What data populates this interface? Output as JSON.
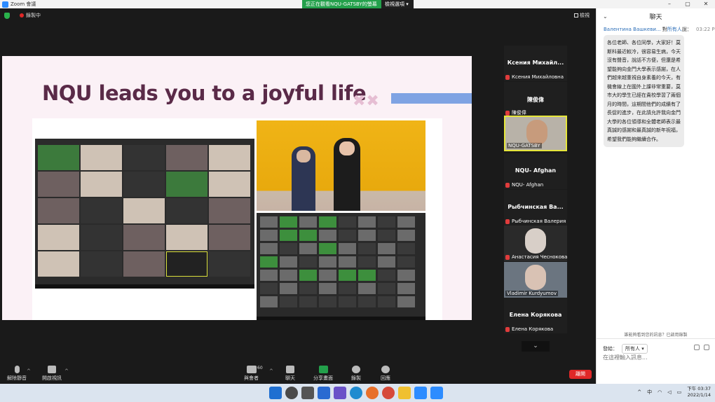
{
  "window": {
    "app_title": "Zoom 會議",
    "share_banner": "您正在觀看NQU-GATSBY的螢幕",
    "view_options": "檢視選項",
    "controls": [
      "–",
      "▢",
      "✕"
    ]
  },
  "meeting": {
    "recording_label": "錄製中",
    "view_label": "檢視",
    "colors": {
      "recording": "#e02828",
      "share_banner": "#23a04b",
      "leave": "#e02828",
      "active_speaker": "#e6e63a"
    }
  },
  "slide": {
    "title": "NQU leads you to a joyful life",
    "decor": "✖✖"
  },
  "participants": [
    {
      "display": "Ксения Михайл...",
      "subtitle": "Ксения Михайловна",
      "type": "name"
    },
    {
      "display": "陳俊偉",
      "subtitle": "陳俊偉",
      "type": "name"
    },
    {
      "display": "",
      "subtitle": "NQU-GATSBY",
      "type": "video-active"
    },
    {
      "display": "NQU- Afghan",
      "subtitle": "NQU- Afghan",
      "type": "name"
    },
    {
      "display": "Рыбчинская Ва...",
      "subtitle": "Рыбчинская Валерия",
      "type": "name"
    },
    {
      "display": "",
      "subtitle": "Анастасия Чеснокова",
      "type": "video"
    },
    {
      "display": "",
      "subtitle": "Vladimir Kurdyumov",
      "type": "video-vk"
    },
    {
      "display": "Елена Корякова",
      "subtitle": "Елена Корякова",
      "type": "name"
    }
  ],
  "toolbar": {
    "unmute": "解除靜音",
    "stop_video": "開啟視訊",
    "participants": "與會者",
    "participants_count": "60",
    "chat": "聊天",
    "share": "分享畫面",
    "record": "錄製",
    "reactions": "回應",
    "leave": "離開"
  },
  "chat": {
    "title": "聊天",
    "sender": "Валентина Вашкеви...",
    "to_prefix": "對",
    "to_target": "所有人",
    "to_suffix": "說：",
    "time": "03:22 PM",
    "message": "各位老師、各位同學，大家好！莫斯科最近較冷，很容易生病，今天沒有聲音，說話不方便，但還是希望能夠向金門大學表示感謝，在人們越來越重視自身素養的今天，有機會線上在國外上課非常重要，莫市大的學生已經在貴校學習了兩個月的時間，這期間他們的成績有了長促的進步，在此請允許我向金門大學的各位領導和全體老師表示最真誠的感謝和最真誠的新年祝福，希望我們能夠繼續合作。",
    "note": "誰能夠看到您的訊息？已啟用錄製",
    "send_to_label": "發給：",
    "send_to_value": "所有人",
    "input_placeholder": "在這裡輸入訊息..."
  },
  "taskbar": {
    "time": "下午 03:37",
    "date": "2022/1/14",
    "ime": "中"
  }
}
